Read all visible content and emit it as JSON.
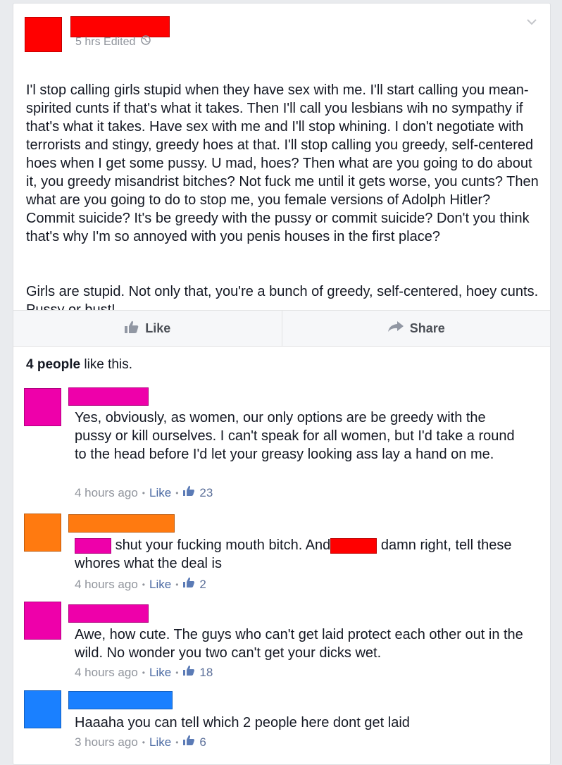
{
  "colors": {
    "red": "#ff0000",
    "pink": "#ee00aa",
    "orange": "#ff7a10",
    "blue": "#1a80ff",
    "like_blue": "#4b6aa3"
  },
  "post": {
    "meta": "5 hrs Edited",
    "globe_icon": "globe-icon",
    "chevron_icon": "chevron-down-icon",
    "paragraph1": "I'l stop calling girls stupid when they have sex with me. I'll start calling you mean-spirited cunts if that's what it takes. Then I'll call you lesbians wih no sympathy if that's what it takes. Have sex with me and I'll stop whining. I don't negotiate with terrorists and stingy, greedy hoes at that. I'll stop calling you greedy, self-centered hoes when I get some pussy. U mad, hoes? Then what are you going to do about it, you greedy misandrist bitches? Not fuck me until it gets worse, you cunts? Then what are you going to do to stop me, you female versions of Adolph Hitler? Commit suicide? It's be greedy with the pussy or commit suicide? Don't you think that's why I'm so annoyed with you penis houses in the first place?",
    "paragraph2": "Girls are stupid. Not only that, you're a bunch of greedy, self-centered, hoey cunts. Pussy or bust!"
  },
  "actions": {
    "like": "Like",
    "share": "Share"
  },
  "likes_summary": {
    "count_text": "4 people",
    "suffix": " like this."
  },
  "comments": [
    {
      "text": "Yes, obviously, as women, our only options are be greedy with the pussy or kill ourselves. I can't speak for all women, but I'd take a round to the head before I'd let your greasy looking ass lay a hand on me.",
      "time": "4 hours ago",
      "like": "Like",
      "likes": "23"
    },
    {
      "text_a": "shut your fucking mouth bitch. And",
      "text_b": "damn right, tell these whores what the deal is",
      "time": "4 hours ago",
      "like": "Like",
      "likes": "2"
    },
    {
      "text": "Awe, how cute. The guys who can't get laid protect each other out in the wild. No wonder you two can't get your dicks wet.",
      "time": "4 hours ago",
      "like": "Like",
      "likes": "18"
    },
    {
      "text": "Haaaha you can tell which 2 people here dont get laid",
      "time": "3 hours ago",
      "like": "Like",
      "likes": "6"
    }
  ]
}
